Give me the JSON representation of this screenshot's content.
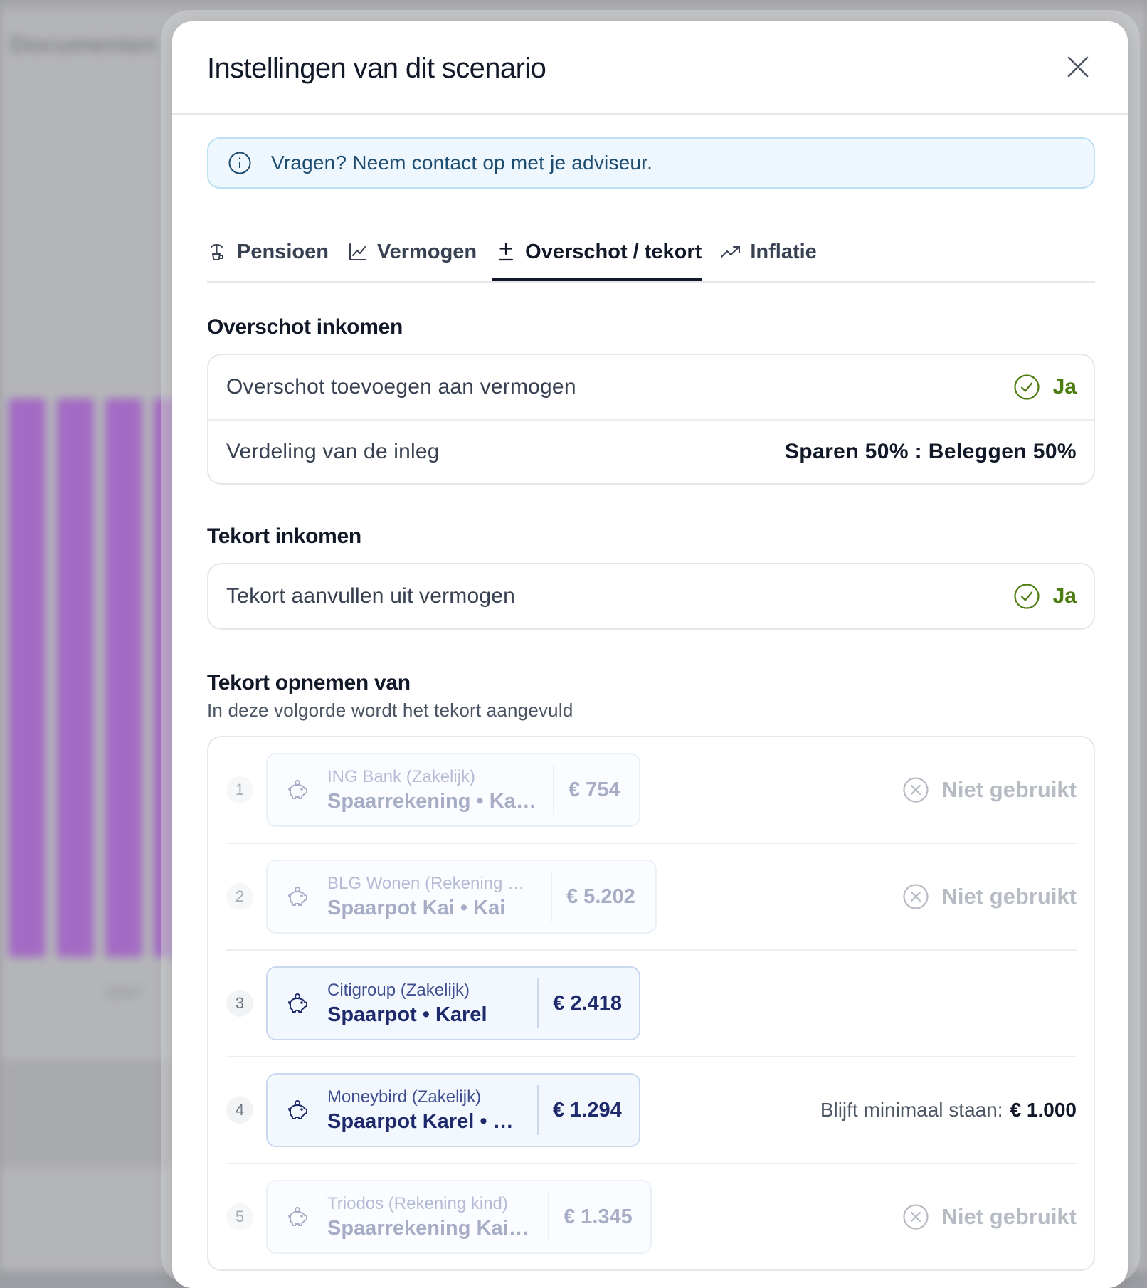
{
  "background": {
    "page_title": "Documenten",
    "year_label": "2047"
  },
  "modal": {
    "title": "Instellingen van dit scenario",
    "info_text": "Vragen? Neem contact op met je adviseur.",
    "tabs": [
      {
        "label": "Pensioen",
        "icon": "pension-icon",
        "active": false
      },
      {
        "label": "Vermogen",
        "icon": "line-chart-icon",
        "active": false
      },
      {
        "label": "Overschot / tekort",
        "icon": "plus-minus-icon",
        "active": true
      },
      {
        "label": "Inflatie",
        "icon": "trend-up-icon",
        "active": false
      }
    ],
    "surplus": {
      "title": "Overschot inkomen",
      "add_label": "Overschot toevoegen aan vermogen",
      "add_value": "Ja",
      "split_label": "Verdeling van de inleg",
      "split_value": "Sparen 50% : Beleggen 50%"
    },
    "deficit": {
      "title": "Tekort inkomen",
      "fill_label": "Tekort aanvullen uit vermogen",
      "fill_value": "Ja"
    },
    "withdraw": {
      "title": "Tekort opnemen van",
      "subtitle": "In deze volgorde wordt het tekort aangevuld",
      "unused_label": "Niet gebruikt",
      "items": [
        {
          "num": "1",
          "bank": "ING Bank (Zakelijk)",
          "name": "Spaarrekening • Karel",
          "amount": "€ 754",
          "used": false
        },
        {
          "num": "2",
          "bank": "BLG Wonen (Rekening …",
          "name": "Spaarpot Kai • Kai",
          "amount": "€ 5.202",
          "used": false
        },
        {
          "num": "3",
          "bank": "Citigroup (Zakelijk)",
          "name": "Spaarpot • Karel",
          "amount": "€ 2.418",
          "used": true
        },
        {
          "num": "4",
          "bank": "Moneybird (Zakelijk)",
          "name": "Spaarpot Karel • K…",
          "amount": "€ 1.294",
          "used": true,
          "min_label": "Blijft minimaal staan:",
          "min_value": "€ 1.000"
        },
        {
          "num": "5",
          "bank": "Triodos (Rekening kind)",
          "name": "Spaarrekening Kai …",
          "amount": "€ 1.345",
          "used": false
        }
      ]
    }
  },
  "colors": {
    "accent_dark": "#111827",
    "success": "#4d7c0f",
    "info_bg": "#eef7fd",
    "account_text": "#1e2a6b",
    "bar_purple": "#a46bc4"
  }
}
